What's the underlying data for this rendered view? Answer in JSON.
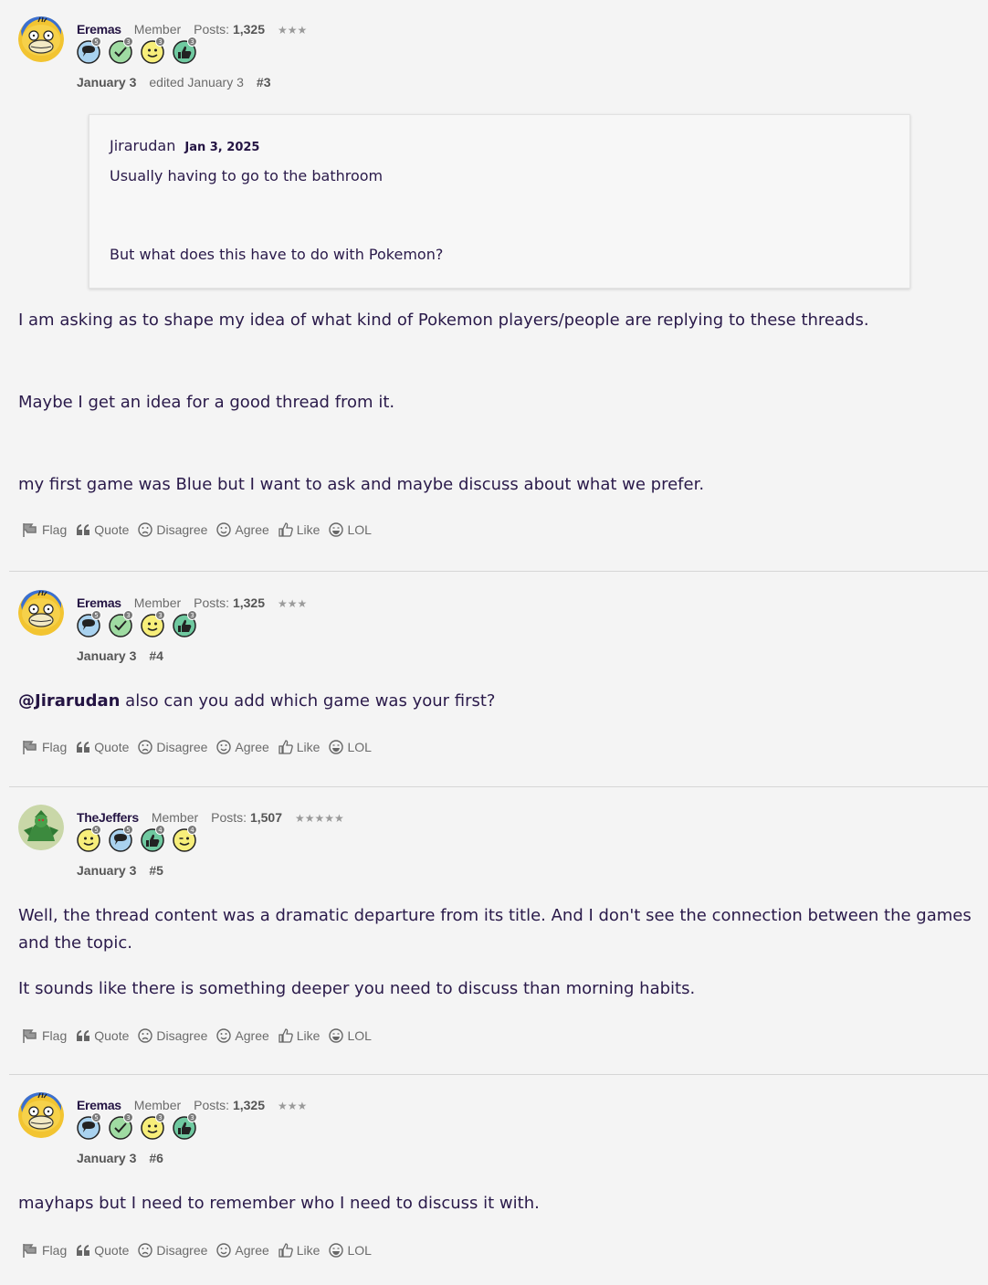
{
  "actions": {
    "flag": "Flag",
    "quote": "Quote",
    "disagree": "Disagree",
    "agree": "Agree",
    "like": "Like",
    "lol": "LOL"
  },
  "colors": {
    "text": "#2a1a4a",
    "muted": "#6b6b6b",
    "background": "#f4f4f4"
  },
  "comments": [
    {
      "author": "Eremas",
      "role": "Member",
      "posts_label": "Posts:",
      "posts": "1,325",
      "stars": "★★★",
      "badges": [
        "5",
        "3",
        "3",
        "3"
      ],
      "date": "January 3",
      "edited": "edited January 3",
      "number": "#3",
      "quote": {
        "author": "Jirarudan",
        "date": "Jan 3, 2025",
        "line1": "Usually having to go to the bathroom",
        "line2": "But what does this have to do with Pokemon?"
      },
      "paragraphs": [
        "I am asking as to shape my idea of what kind of Pokemon players/people are replying to these threads.",
        "Maybe I get an idea for a good thread from it.",
        "my first game was Blue but I want to ask and maybe discuss about what we prefer."
      ]
    },
    {
      "author": "Eremas",
      "role": "Member",
      "posts_label": "Posts:",
      "posts": "1,325",
      "stars": "★★★",
      "badges": [
        "5",
        "3",
        "3",
        "3"
      ],
      "date": "January 3",
      "number": "#4",
      "mention": "@Jirarudan",
      "text": "also can you add which game was your first?"
    },
    {
      "author": "TheJeffers",
      "role": "Member",
      "posts_label": "Posts:",
      "posts": "1,507",
      "stars": "★★★★★",
      "badges": [
        "5",
        "5",
        "4",
        "4"
      ],
      "date": "January 3",
      "number": "#5",
      "paragraphs": [
        "Well, the thread content was a dramatic departure from its title. And I don't see the connection between the games and the topic.",
        "It sounds like there is something deeper you need to discuss than morning habits."
      ]
    },
    {
      "author": "Eremas",
      "role": "Member",
      "posts_label": "Posts:",
      "posts": "1,325",
      "stars": "★★★",
      "badges": [
        "5",
        "3",
        "3",
        "3"
      ],
      "date": "January 3",
      "number": "#6",
      "paragraphs": [
        "mayhaps but I need to remember who I need to discuss it with."
      ]
    }
  ]
}
